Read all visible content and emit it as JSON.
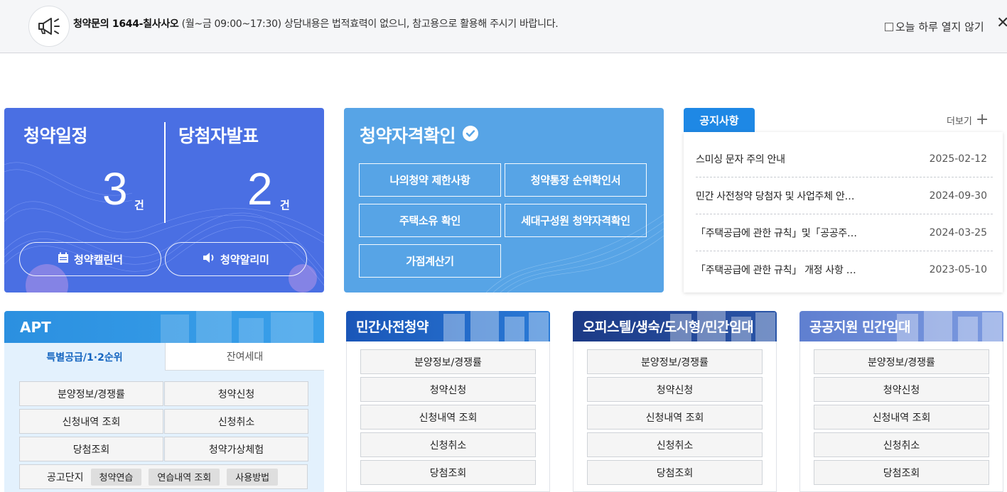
{
  "notice": {
    "phone_label": "청약문의 1644-칠사사오",
    "hours": "(월~금 09:00~17:30)",
    "message": "상담내용은 법적효력이 없으니, 참고용으로 활용해 주시기 바랍니다.",
    "dismiss_label": "오늘 하루 열지 않기",
    "close_symbol": "✕"
  },
  "schedule_card": {
    "schedule_title": "청약일정",
    "schedule_count": "3",
    "winner_title": "당첨자발표",
    "winner_count": "2",
    "unit": "건",
    "calendar_label": "청약캘린더",
    "alarm_label": "청약알리미"
  },
  "eligibility_card": {
    "title": "청약자격확인",
    "buttons": [
      "나의청약 제한사항",
      "청약통장 순위확인서",
      "주택소유 확인",
      "세대구성원 청약자격확인",
      "가점계산기"
    ]
  },
  "notice_board": {
    "tab_label": "공지사항",
    "more_label": "더보기",
    "items": [
      {
        "title": "스미싱 문자 주의 안내",
        "date": "2025-02-12"
      },
      {
        "title": "민간 사전청약 당첨자 및 사업주체 안…",
        "date": "2024-09-30"
      },
      {
        "title": "「주택공급에 관한 규칙」및「공공주…",
        "date": "2024-03-25"
      },
      {
        "title": "「주택공급에 관한 규칙」 개정 사항 …",
        "date": "2023-05-10"
      }
    ]
  },
  "apt": {
    "title": "APT",
    "tab_active": "특별공급/1·2순위",
    "tab_inactive": "잔여세대",
    "buttons": [
      "분양정보/경쟁률",
      "청약신청",
      "신청내역 조회",
      "신청취소",
      "당첨조회",
      "청약가상체험"
    ],
    "bottom_label": "공고단지",
    "chips": [
      "청약연습",
      "연습내역 조회",
      "사용방법"
    ]
  },
  "panels": [
    {
      "title": "민간사전청약",
      "items": [
        "분양정보/경쟁률",
        "청약신청",
        "신청내역 조회",
        "신청취소",
        "당첨조회"
      ]
    },
    {
      "title": "오피스텔/생숙/도시형/민간임대",
      "items": [
        "분양정보/경쟁률",
        "청약신청",
        "신청내역 조회",
        "신청취소",
        "당첨조회"
      ]
    },
    {
      "title": "공공지원 민간임대",
      "items": [
        "분양정보/경쟁률",
        "청약신청",
        "신청내역 조회",
        "신청취소",
        "당첨조회"
      ]
    }
  ],
  "colors": {
    "schedule_bg": "#4a6fe3",
    "eligibility_bg": "#57a4e6",
    "notice_tab": "#1e88e5",
    "panel_private_pre": "#1f5fc2",
    "panel_officetel": "#1e3c8c",
    "panel_public_rental": "#6a8ad6"
  },
  "icons": [
    "megaphone-icon",
    "close-icon",
    "calendar-icon",
    "speaker-icon",
    "check-circle-icon",
    "plus-icon"
  ]
}
